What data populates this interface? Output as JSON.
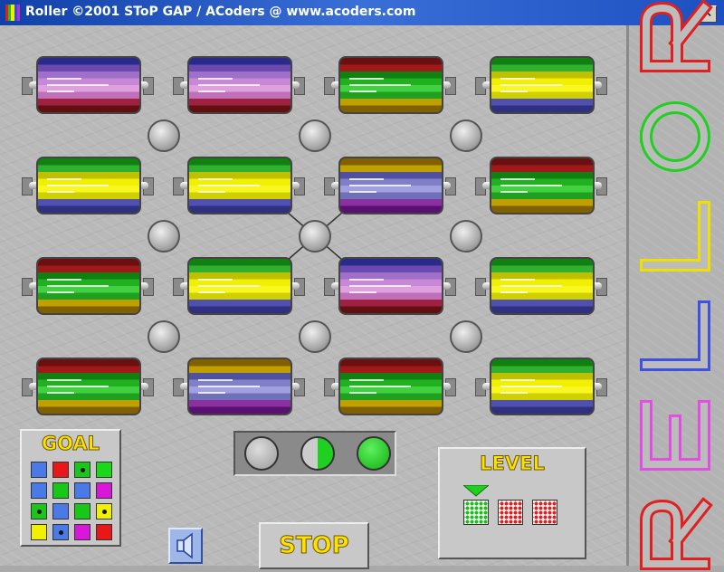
{
  "window": {
    "title": "Roller ©2001 SToP GAP / ACoders @ www.acoders.com",
    "close_label": "✕"
  },
  "colors": {
    "purple": [
      "#2a2a8a",
      "#6a4ab0",
      "#a070c8",
      "#c888d8",
      "#e0a0e0",
      "#c070b8",
      "#a02040",
      "#601010"
    ],
    "green": [
      "#6a1010",
      "#a01818",
      "#108010",
      "#20b020",
      "#40d040",
      "#20a020",
      "#c0a000",
      "#806000"
    ],
    "yellow": [
      "#108010",
      "#30b030",
      "#c0c000",
      "#f0f000",
      "#f8f820",
      "#d0d000",
      "#5050b0",
      "#303080"
    ],
    "lavender": [
      "#806000",
      "#c0a000",
      "#5050a0",
      "#8080c8",
      "#a0a0e0",
      "#7070b8",
      "#8a30a0",
      "#5a1070"
    ]
  },
  "board": {
    "rows": [
      [
        "purple",
        "purple",
        "green",
        "yellow"
      ],
      [
        "yellow",
        "yellow",
        "lavender",
        "green"
      ],
      [
        "green",
        "yellow",
        "purple",
        "yellow"
      ],
      [
        "green",
        "lavender",
        "green",
        "yellow"
      ]
    ]
  },
  "goal": {
    "title": "GOAL",
    "cells": [
      [
        "#4a7ae8",
        "#e81818",
        "#18c818",
        "#18d818"
      ],
      [
        "#4a7ae8",
        "#18c818",
        "#4a7ae8",
        "#d818d8"
      ],
      [
        "#18c818",
        "#4a7ae8",
        "#18c818",
        "#f0f000"
      ],
      [
        "#f0f000",
        "#4a7ae8",
        "#d818d8",
        "#e81818"
      ]
    ],
    "dots": [
      [
        0,
        2
      ],
      [
        2,
        0
      ],
      [
        2,
        3
      ],
      [
        3,
        1
      ]
    ]
  },
  "indicators": {
    "states": [
      "empty",
      "half",
      "full"
    ]
  },
  "controls": {
    "stop_label": "STOP",
    "sound_icon": "speaker-icon"
  },
  "level": {
    "title": "LEVEL",
    "options": [
      "#18c018",
      "#e02020",
      "#e02020"
    ],
    "selected": 0
  },
  "brand": {
    "letters": [
      "R",
      "E",
      "L",
      "L",
      "O",
      "R"
    ],
    "colors": [
      "#e02020",
      "#e050e0",
      "#4050e0",
      "#f0e000",
      "#20d020",
      "#e02020"
    ]
  }
}
